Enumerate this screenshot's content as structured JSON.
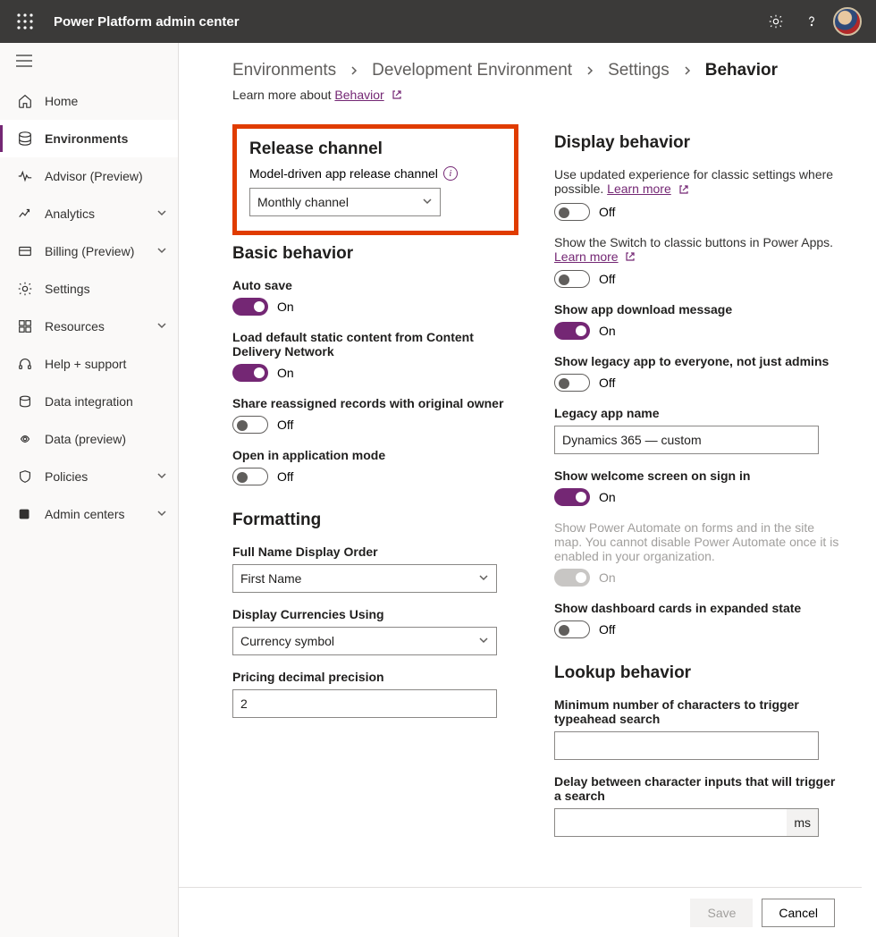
{
  "header": {
    "app_title": "Power Platform admin center"
  },
  "sidebar": {
    "items": [
      {
        "label": "Home"
      },
      {
        "label": "Environments"
      },
      {
        "label": "Advisor (Preview)"
      },
      {
        "label": "Analytics"
      },
      {
        "label": "Billing (Preview)"
      },
      {
        "label": "Settings"
      },
      {
        "label": "Resources"
      },
      {
        "label": "Help + support"
      },
      {
        "label": "Data integration"
      },
      {
        "label": "Data (preview)"
      },
      {
        "label": "Policies"
      },
      {
        "label": "Admin centers"
      }
    ]
  },
  "breadcrumb": {
    "items": [
      "Environments",
      "Development Environment",
      "Settings",
      "Behavior"
    ]
  },
  "learn_more": {
    "prefix": "Learn more about ",
    "link": "Behavior"
  },
  "release": {
    "heading": "Release channel",
    "label": "Model-driven app release channel",
    "value": "Monthly channel"
  },
  "basic": {
    "heading": "Basic behavior",
    "auto_save": {
      "label": "Auto save",
      "state": "On"
    },
    "cdn": {
      "label": "Load default static content from Content Delivery Network",
      "state": "On"
    },
    "share_reassigned": {
      "label": "Share reassigned records with original owner",
      "state": "Off"
    },
    "app_mode": {
      "label": "Open in application mode",
      "state": "Off"
    }
  },
  "formatting": {
    "heading": "Formatting",
    "full_name": {
      "label": "Full Name Display Order",
      "value": "First Name"
    },
    "currencies": {
      "label": "Display Currencies Using",
      "value": "Currency symbol"
    },
    "precision": {
      "label": "Pricing decimal precision",
      "value": "2"
    }
  },
  "display": {
    "heading": "Display behavior",
    "updated_exp": {
      "text": "Use updated experience for classic settings where possible. ",
      "link": "Learn more",
      "state": "Off"
    },
    "switch_classic": {
      "text": "Show the Switch to classic buttons in Power Apps. ",
      "link": "Learn more",
      "state": "Off"
    },
    "download_msg": {
      "label": "Show app download message",
      "state": "On"
    },
    "legacy_everyone": {
      "label": "Show legacy app to everyone, not just admins",
      "state": "Off"
    },
    "legacy_name": {
      "label": "Legacy app name",
      "value": "Dynamics 365 — custom"
    },
    "welcome": {
      "label": "Show welcome screen on sign in",
      "state": "On"
    },
    "power_automate": {
      "text": "Show Power Automate on forms and in the site map. You cannot disable Power Automate once it is enabled in your organization.",
      "state": "On"
    },
    "dashboard_expanded": {
      "label": "Show dashboard cards in expanded state",
      "state": "Off"
    }
  },
  "lookup": {
    "heading": "Lookup behavior",
    "min_chars": {
      "label": "Minimum number of characters to trigger typeahead search",
      "value": ""
    },
    "delay": {
      "label": "Delay between character inputs that will trigger a search",
      "value": "",
      "suffix": "ms"
    }
  },
  "footer": {
    "save": "Save",
    "cancel": "Cancel"
  }
}
